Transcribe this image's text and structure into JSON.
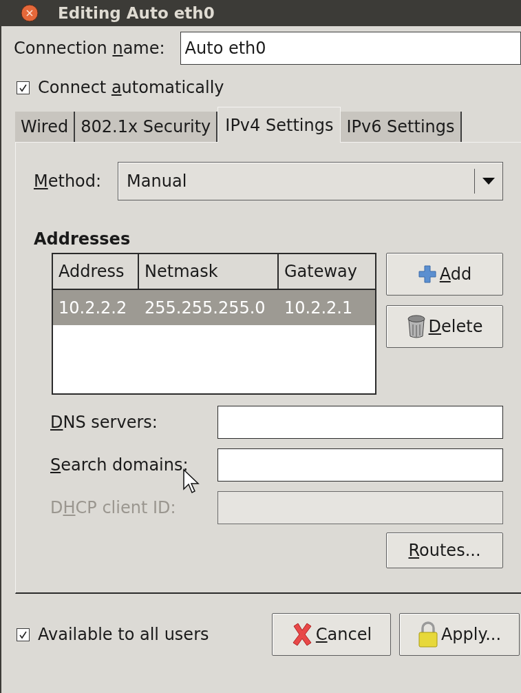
{
  "window": {
    "title": "Editing Auto eth0"
  },
  "connection_name": {
    "label": {
      "before": "Connection ",
      "key": "n",
      "after": "ame:"
    },
    "value": "Auto eth0"
  },
  "connect_automatically": {
    "label": {
      "before": "Connect ",
      "key": "a",
      "after": "utomatically"
    },
    "checked": true
  },
  "tabs": [
    {
      "label": "Wired",
      "selected": false
    },
    {
      "label": "802.1x Security",
      "selected": false
    },
    {
      "label": "IPv4 Settings",
      "selected": true
    },
    {
      "label": "IPv6 Settings",
      "selected": false
    }
  ],
  "method": {
    "label": {
      "key": "M",
      "after": "ethod:"
    },
    "value": "Manual"
  },
  "addresses": {
    "heading": "Addresses",
    "columns": [
      "Address",
      "Netmask",
      "Gateway"
    ],
    "rows": [
      {
        "cells": [
          "10.2.2.2",
          "255.255.255.0",
          "10.2.2.1"
        ],
        "selected": true
      }
    ],
    "buttons": [
      {
        "kind": "add",
        "label": {
          "key": "A",
          "after": "dd"
        }
      },
      {
        "kind": "delete",
        "label": {
          "key": "D",
          "after": "elete"
        }
      }
    ]
  },
  "fields": [
    {
      "label": {
        "key": "D",
        "after": "NS servers:"
      },
      "disabled": false
    },
    {
      "label": {
        "key": "S",
        "after": "earch domains:"
      },
      "disabled": false
    },
    {
      "label": {
        "before": "D",
        "key": "H",
        "after": "CP client ID:"
      },
      "disabled": true
    }
  ],
  "routes_button": {
    "label": {
      "key": "R",
      "after": "outes..."
    }
  },
  "available_to_all_users": {
    "label": {
      "before": "Available to all users"
    },
    "checked": true
  },
  "buttons": [
    {
      "kind": "cancel",
      "label": {
        "key": "C",
        "after": "ancel"
      }
    },
    {
      "kind": "apply",
      "label": {
        "before": "Apply..."
      }
    }
  ]
}
